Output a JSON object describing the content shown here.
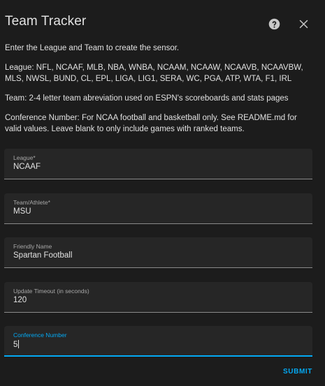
{
  "dialog": {
    "title": "Team Tracker",
    "help_icon": "help-circle-icon",
    "close_icon": "close-icon"
  },
  "description": {
    "intro": "Enter the League and Team to create the sensor.",
    "leagues": "League: NFL, NCAAF, MLB, NBA, WNBA, NCAAM, NCAAW, NCAAVB, NCAAVBW, MLS, NWSL, BUND, CL, EPL, LIGA, LIG1, SERA, WC, PGA, ATP, WTA, F1, IRL",
    "team": "Team: 2-4 letter team abreviation used on ESPN's scoreboards and stats pages",
    "conference": "Conference Number: For NCAA football and basketball only. See README.md for valid values. Leave blank to only include games with ranked teams."
  },
  "fields": {
    "league": {
      "label": "League*",
      "value": "NCAAF"
    },
    "team": {
      "label": "Team/Athlete*",
      "value": "MSU"
    },
    "name": {
      "label": "Friendly Name",
      "value": "Spartan Football"
    },
    "timeout": {
      "label": "Update Timeout (in seconds)",
      "value": "120"
    },
    "conference": {
      "label": "Conference Number",
      "value": "5"
    }
  },
  "actions": {
    "submit_label": "SUBMIT"
  },
  "colors": {
    "accent": "#03a9f4",
    "dialog_bg": "#1c1c1c",
    "field_bg": "#262626",
    "text": "#e1e1e1"
  }
}
